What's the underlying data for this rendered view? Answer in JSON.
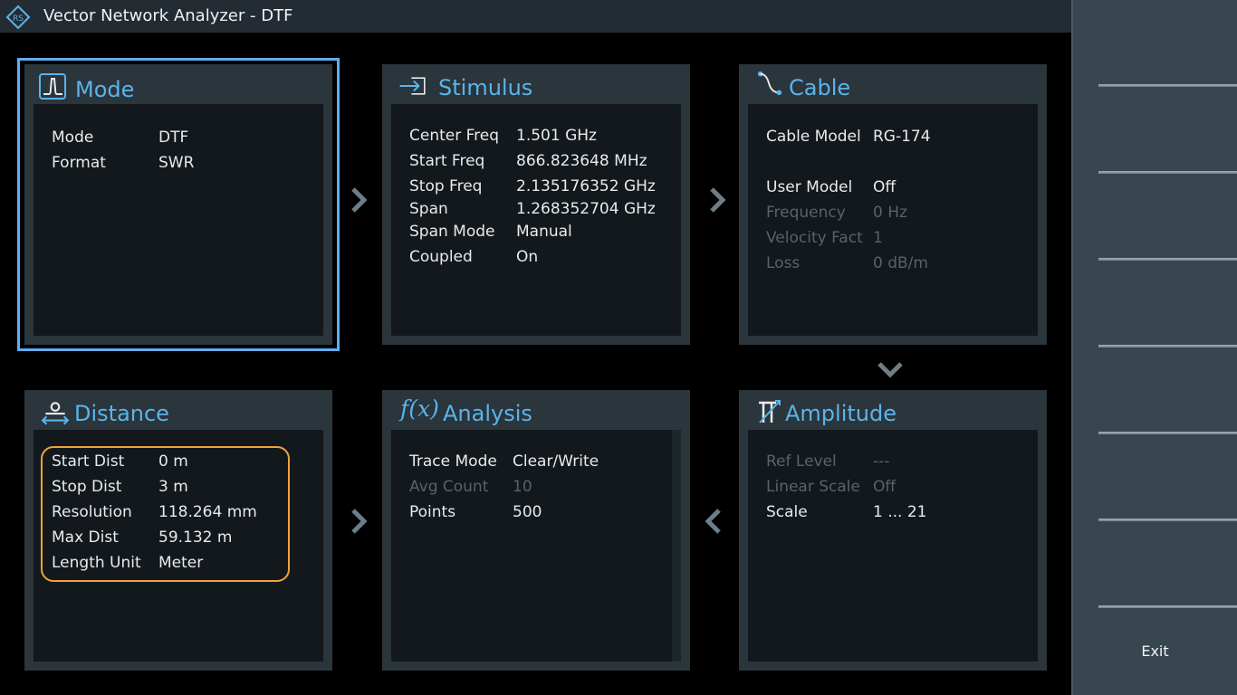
{
  "app": {
    "title": "Vector Network Analyzer - DTF"
  },
  "colors": {
    "accent": "#5ab4ea",
    "highlight": "#f0a23a",
    "selection": "#5eaef0"
  },
  "sidebar": {
    "exit_label": "Exit",
    "softkey_count": 7
  },
  "panels": {
    "mode": {
      "title": "Mode",
      "icon": "pulse-icon",
      "rows": [
        {
          "label": "Mode",
          "value": "DTF",
          "enabled": true
        },
        {
          "label": "Format",
          "value": "SWR",
          "enabled": true
        }
      ]
    },
    "stimulus": {
      "title": "Stimulus",
      "icon": "arrow-into-box-icon",
      "rows": [
        {
          "label": "Center Freq",
          "value": "1.501 GHz",
          "enabled": true
        },
        {
          "label": "Start Freq",
          "value": "866.823648 MHz",
          "enabled": true
        },
        {
          "label": "Stop Freq",
          "value": "2.135176352 GHz",
          "enabled": true
        },
        {
          "label": "Span",
          "value": "1.268352704 GHz",
          "enabled": true
        },
        {
          "label": "Span Mode",
          "value": "Manual",
          "enabled": true
        },
        {
          "label": "Coupled",
          "value": "On",
          "enabled": true
        }
      ]
    },
    "cable": {
      "title": "Cable",
      "icon": "cable-curve-icon",
      "rows": [
        {
          "label": "Cable Model",
          "value": "RG-174",
          "enabled": true
        },
        {
          "label": "User Model",
          "value": "Off",
          "enabled": true
        },
        {
          "label": "Frequency",
          "value": "0 Hz",
          "enabled": false
        },
        {
          "label": "Velocity Fact",
          "value": "1",
          "enabled": false
        },
        {
          "label": "Loss",
          "value": "0 dB/m",
          "enabled": false
        }
      ]
    },
    "distance": {
      "title": "Distance",
      "icon": "distance-marker-icon",
      "rows": [
        {
          "label": "Start Dist",
          "value": "0 m",
          "enabled": true
        },
        {
          "label": "Stop Dist",
          "value": "3 m",
          "enabled": true
        },
        {
          "label": "Resolution",
          "value": "118.264 mm",
          "enabled": true
        },
        {
          "label": "Max Dist",
          "value": "59.132 m",
          "enabled": true
        },
        {
          "label": "Length Unit",
          "value": "Meter",
          "enabled": true
        }
      ]
    },
    "analysis": {
      "title": "Analysis",
      "icon": "function-fx-icon",
      "icon_text": "f(x)",
      "rows": [
        {
          "label": "Trace Mode",
          "value": "Clear/Write",
          "enabled": true
        },
        {
          "label": "Avg Count",
          "value": "10",
          "enabled": false
        },
        {
          "label": "Points",
          "value": "500",
          "enabled": true
        }
      ]
    },
    "amplitude": {
      "title": "Amplitude",
      "icon": "amplitude-scale-icon",
      "rows": [
        {
          "label": "Ref Level",
          "value": "---",
          "enabled": false
        },
        {
          "label": "Linear Scale",
          "value": "Off",
          "enabled": false
        },
        {
          "label": "Scale",
          "value": "1 ... 21",
          "enabled": true
        }
      ]
    }
  }
}
